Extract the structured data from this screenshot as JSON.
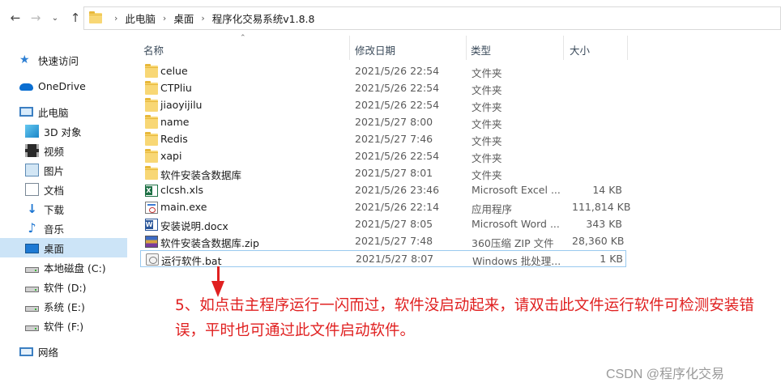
{
  "address_bar": {
    "back_icon": "back-arrow-icon",
    "forward_icon": "forward-arrow-icon",
    "dropdown_icon": "chevron-down-icon",
    "up_icon": "up-arrow-icon",
    "crumbs": [
      "此电脑",
      "桌面",
      "程序化交易系统v1.8.8"
    ]
  },
  "nav": {
    "items": [
      {
        "label": "快速访问",
        "icon": "star-icon"
      },
      {
        "label": "OneDrive",
        "icon": "onedrive-cloud-icon"
      },
      {
        "label": "此电脑",
        "icon": "computer-icon"
      },
      {
        "label": "3D 对象",
        "icon": "3d-objects-icon"
      },
      {
        "label": "视频",
        "icon": "video-icon"
      },
      {
        "label": "图片",
        "icon": "pictures-icon"
      },
      {
        "label": "文档",
        "icon": "documents-icon"
      },
      {
        "label": "下载",
        "icon": "download-icon"
      },
      {
        "label": "音乐",
        "icon": "music-icon"
      },
      {
        "label": "桌面",
        "icon": "desktop-icon"
      },
      {
        "label": "本地磁盘 (C:)",
        "icon": "windows-drive-icon"
      },
      {
        "label": "软件 (D:)",
        "icon": "drive-icon"
      },
      {
        "label": "系统 (E:)",
        "icon": "drive-icon"
      },
      {
        "label": "软件 (F:)",
        "icon": "drive-icon"
      },
      {
        "label": "网络",
        "icon": "network-icon"
      }
    ],
    "selected": "桌面"
  },
  "columns": {
    "name": "名称",
    "date": "修改日期",
    "type": "类型",
    "size": "大小",
    "sort_icon": "sort-ascending-caret-icon"
  },
  "files": [
    {
      "name": "celue",
      "date": "2021/5/26 22:54",
      "type": "文件夹",
      "size": "",
      "icon": "folder-icon"
    },
    {
      "name": "CTPliu",
      "date": "2021/5/26 22:54",
      "type": "文件夹",
      "size": "",
      "icon": "folder-icon"
    },
    {
      "name": "jiaoyijilu",
      "date": "2021/5/26 22:54",
      "type": "文件夹",
      "size": "",
      "icon": "folder-icon"
    },
    {
      "name": "name",
      "date": "2021/5/27 8:00",
      "type": "文件夹",
      "size": "",
      "icon": "folder-icon"
    },
    {
      "name": "Redis",
      "date": "2021/5/27 7:46",
      "type": "文件夹",
      "size": "",
      "icon": "folder-icon"
    },
    {
      "name": "xapi",
      "date": "2021/5/26 22:54",
      "type": "文件夹",
      "size": "",
      "icon": "folder-icon"
    },
    {
      "name": "软件安装含数据库",
      "date": "2021/5/27 8:01",
      "type": "文件夹",
      "size": "",
      "icon": "folder-icon"
    },
    {
      "name": "clcsh.xls",
      "date": "2021/5/26 23:46",
      "type": "Microsoft Excel ...",
      "size": "14 KB",
      "icon": "excel-file-icon"
    },
    {
      "name": "main.exe",
      "date": "2021/5/26 22:14",
      "type": "应用程序",
      "size": "111,814 KB",
      "icon": "exe-file-icon"
    },
    {
      "name": "安装说明.docx",
      "date": "2021/5/27 8:05",
      "type": "Microsoft Word ...",
      "size": "343 KB",
      "icon": "word-file-icon"
    },
    {
      "name": "软件安装含数据库.zip",
      "date": "2021/5/27 7:48",
      "type": "360压缩 ZIP 文件",
      "size": "28,360 KB",
      "icon": "zip-file-icon"
    },
    {
      "name": "运行软件.bat",
      "date": "2021/5/27 8:07",
      "type": "Windows 批处理...",
      "size": "1 KB",
      "icon": "bat-file-icon"
    }
  ],
  "highlighted_file": "运行软件.bat",
  "annotation": {
    "arrow_icon": "red-arrow-down-icon",
    "text": "5、如点击主程序运行一闪而过，软件没启动起来，请双击此文件运行软件可检测安装错误，平时也可通过此文件启动软件。",
    "color": "#e02020"
  },
  "watermark": "CSDN @程序化交易",
  "colors": {
    "selection": "#cce4f7",
    "highlight_border": "#99c9ef",
    "folder": "#f8d775"
  }
}
